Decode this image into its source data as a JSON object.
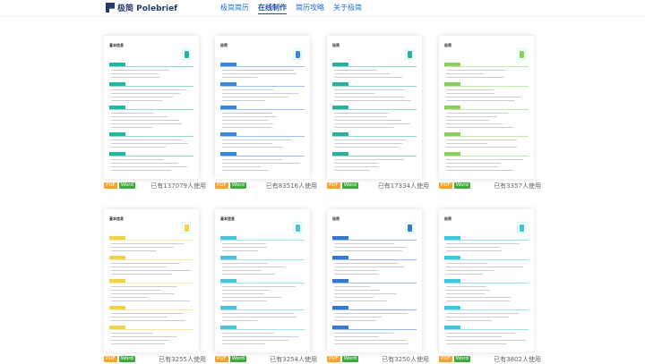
{
  "brand": {
    "name": "极简 Polebrief"
  },
  "nav": [
    "极简简历",
    "在线制作",
    "简历攻略",
    "关于极简"
  ],
  "nav_active_index": 1,
  "templates": [
    {
      "name": "基本信息",
      "accent": "#1fb7a0",
      "usage": "已有137079人使用",
      "pdf": "PDF",
      "word": "Word"
    },
    {
      "name": "极简",
      "accent": "#3a86d8",
      "usage": "已有83516人使用",
      "pdf": "PDF",
      "word": "Word"
    },
    {
      "name": "极简",
      "accent": "#2ab09e",
      "usage": "已有17334人使用",
      "pdf": "PDF",
      "word": "Word"
    },
    {
      "name": "极简",
      "accent": "#8bcf5a",
      "usage": "已有3357人使用",
      "pdf": "PDF",
      "word": "Word"
    },
    {
      "name": "基本信息",
      "accent": "#f0d34a",
      "usage": "已有3255人使用",
      "pdf": "PDF",
      "word": "Word"
    },
    {
      "name": "基本信息",
      "accent": "#4dc4d6",
      "usage": "已有3254人使用",
      "pdf": "PDF",
      "word": "Word"
    },
    {
      "name": "极简",
      "accent": "#3478d0",
      "usage": "已有3250人使用",
      "pdf": "PDF",
      "word": "Word"
    },
    {
      "name": "极简",
      "accent": "#3ec6e0",
      "usage": "已有3802人使用",
      "pdf": "PDF",
      "word": "Word"
    }
  ]
}
